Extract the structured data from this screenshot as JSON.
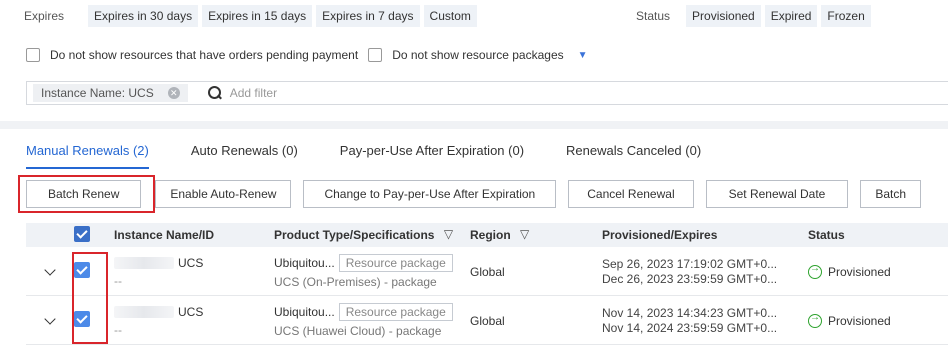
{
  "filters": {
    "expires_label": "Expires",
    "expires_options": [
      "Expires in 30 days",
      "Expires in 15 days",
      "Expires in 7 days",
      "Custom"
    ],
    "status_label": "Status",
    "status_options": [
      "Provisioned",
      "Expired",
      "Frozen"
    ],
    "pending_payment_label": "Do not show resources that have orders pending payment",
    "resource_packages_label": "Do not show resource packages"
  },
  "search": {
    "tag_label": "Instance Name: UCS",
    "placeholder": "Add filter"
  },
  "tabs": [
    "Manual Renewals (2)",
    "Auto Renewals (0)",
    "Pay-per-Use After Expiration (0)",
    "Renewals Canceled (0)"
  ],
  "buttons": [
    "Batch Renew",
    "Enable Auto-Renew",
    "Change to Pay-per-Use After Expiration",
    "Cancel Renewal",
    "Set Renewal Date",
    "Batch"
  ],
  "table": {
    "headers": {
      "name": "Instance Name/ID",
      "product": "Product Type/Specifications",
      "region": "Region",
      "provisioned": "Provisioned/Expires",
      "status": "Status"
    },
    "rows": [
      {
        "name_suffix": "UCS",
        "id": "--",
        "product_type": "Ubiquitou...",
        "badge": "Resource package",
        "spec": "UCS (On-Premises) - package",
        "region": "Global",
        "provisioned": "Sep 26, 2023 17:19:02 GMT+0...",
        "expires": "Dec 26, 2023 23:59:59 GMT+0...",
        "status": "Provisioned"
      },
      {
        "name_suffix": "UCS",
        "id": "--",
        "product_type": "Ubiquitou...",
        "badge": "Resource package",
        "spec": "UCS (Huawei Cloud) - package",
        "region": "Global",
        "provisioned": "Nov 14, 2023 14:34:23 GMT+0...",
        "expires": "Nov 14, 2024 23:59:59 GMT+0...",
        "status": "Provisioned"
      }
    ]
  },
  "colors": {
    "accent": "#2467d3",
    "checkbox": "#4c8ae8",
    "highlight": "#d9252b",
    "status_ok": "#2ea32e"
  }
}
